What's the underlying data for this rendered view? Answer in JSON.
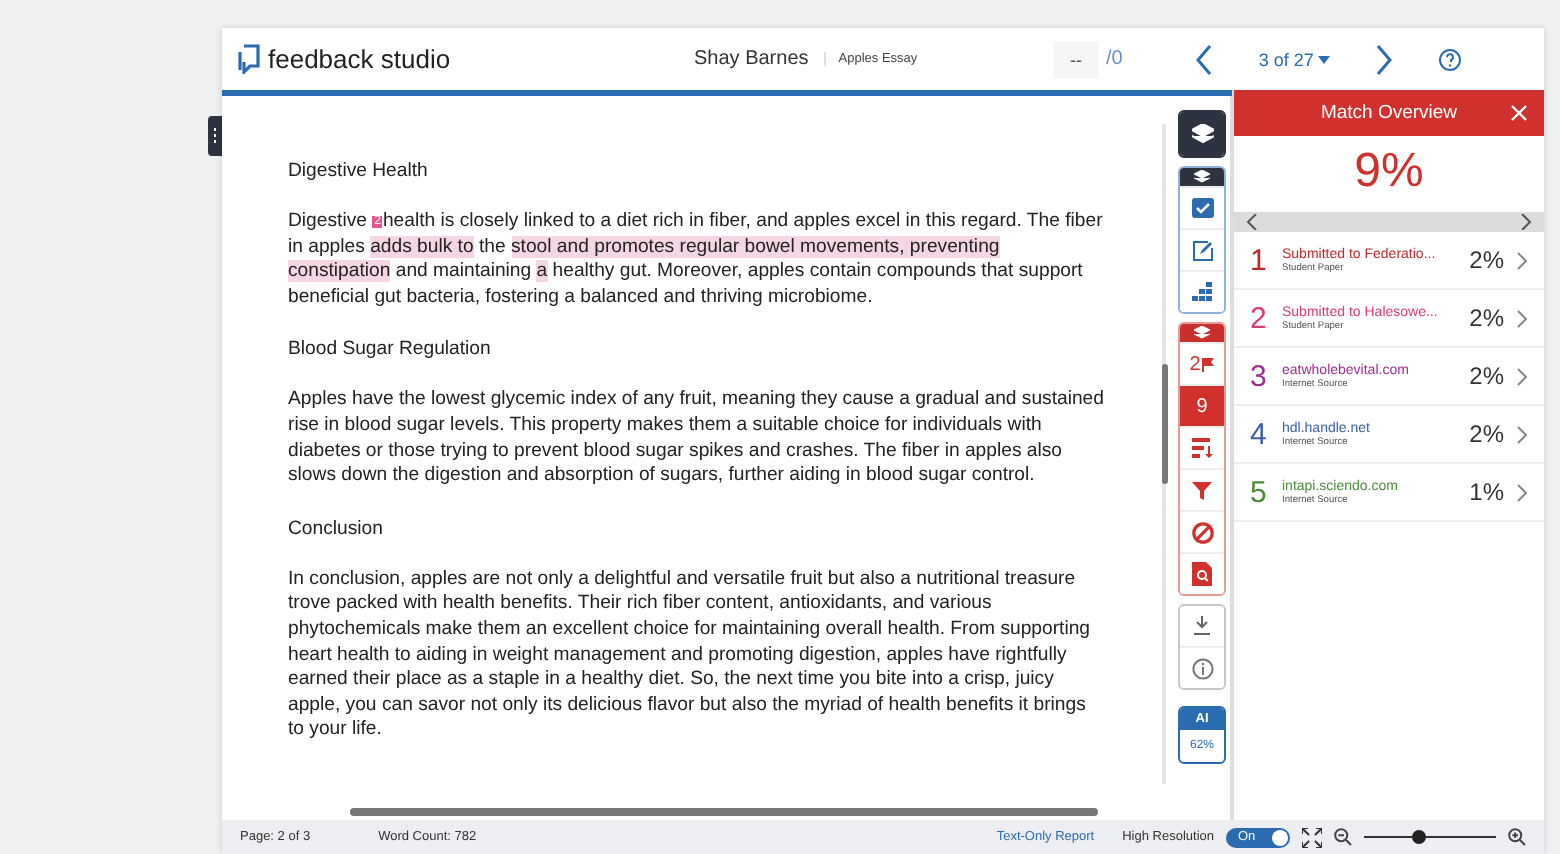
{
  "header": {
    "logo": "feedback studio",
    "student": "Shay Barnes",
    "title": "Apples Essay",
    "grade": "--",
    "grade_total": "/0",
    "position": "3 of 27"
  },
  "document": {
    "blocks": [
      {
        "kind": "heading",
        "text": "Digestive Health"
      },
      {
        "kind": "paragraph",
        "segments": [
          {
            "kind": "plain",
            "text": "Digestive "
          },
          {
            "kind": "marker",
            "text": "2"
          },
          {
            "kind": "plain",
            "text": "health is closely linked to a diet rich in fiber, and apples excel in this regard. The fiber in apples "
          },
          {
            "kind": "match",
            "text": "adds bulk to"
          },
          {
            "kind": "plain",
            "text": " the "
          },
          {
            "kind": "match",
            "text": "stool and promotes regular bowel movements, preventing constipation"
          },
          {
            "kind": "plain",
            "text": " and maintaining "
          },
          {
            "kind": "match",
            "text": "a"
          },
          {
            "kind": "plain",
            "text": " healthy gut. Moreover, apples contain compounds that support beneficial gut bacteria, fostering a balanced and thriving microbiome."
          }
        ]
      },
      {
        "kind": "heading",
        "text": "Blood Sugar Regulation"
      },
      {
        "kind": "paragraph",
        "segments": [
          {
            "kind": "plain",
            "text": "Apples have the lowest glycemic index of any fruit, meaning they cause a gradual and sustained rise in blood sugar levels. This property makes them a suitable choice for individuals with diabetes or those trying to prevent blood sugar spikes and crashes. The fiber in apples also slows down the digestion and absorption of sugars, further aiding in blood sugar control."
          }
        ]
      },
      {
        "kind": "heading",
        "text": "Conclusion"
      },
      {
        "kind": "paragraph",
        "segments": [
          {
            "kind": "plain",
            "text": "In conclusion, apples are not only a delightful and versatile fruit but also a nutritional treasure trove packed with health benefits. Their rich fiber content, antioxidants, and various phytochemicals make them an excellent choice for maintaining overall health. From supporting heart health to aiding in weight management and promoting digestion, apples have rightfully earned their place as a staple in a healthy diet. So, the next time you bite into a crisp, juicy apple, you can savor not only its delicious flavor but also the myriad of health benefits it brings to your life."
          }
        ]
      }
    ]
  },
  "tool_groups": [
    {
      "kind": "layers",
      "tools": [
        {
          "kind": "layers"
        }
      ]
    },
    {
      "kind": "grading",
      "tools": [
        {
          "kind": "head"
        },
        {
          "kind": "check"
        },
        {
          "kind": "edit"
        },
        {
          "kind": "grid"
        }
      ]
    },
    {
      "kind": "similarity",
      "tools": [
        {
          "kind": "head"
        },
        {
          "kind": "flags",
          "label": "2",
          "selected": false
        },
        {
          "kind": "count",
          "label": "9",
          "selected": true
        },
        {
          "kind": "list",
          "selected": false
        },
        {
          "kind": "filter",
          "selected": false
        },
        {
          "kind": "exclude",
          "selected": false
        },
        {
          "kind": "docsearch",
          "selected": false
        }
      ]
    },
    {
      "kind": "misc",
      "tools": [
        {
          "kind": "download"
        },
        {
          "kind": "info"
        }
      ]
    },
    {
      "kind": "ai",
      "label": "AI",
      "value": "62%"
    }
  ],
  "panel": {
    "title": "Match Overview",
    "percent": "9%",
    "matches": [
      {
        "number": "1",
        "source": "Submitted to Federatio...",
        "type": "Student Paper",
        "percent": "2%",
        "color": "#c0272d"
      },
      {
        "number": "2",
        "source": "Submitted to Halesowe...",
        "type": "Student Paper",
        "percent": "2%",
        "color": "#d63c7a"
      },
      {
        "number": "3",
        "source": "eatwholebevital.com",
        "type": "Internet Source",
        "percent": "2%",
        "color": "#9b2f8f"
      },
      {
        "number": "4",
        "source": "hdl.handle.net",
        "type": "Internet Source",
        "percent": "2%",
        "color": "#3a5ea8"
      },
      {
        "number": "5",
        "source": "intapi.sciendo.com",
        "type": "Internet Source",
        "percent": "1%",
        "color": "#4a8c3a"
      }
    ]
  },
  "footer": {
    "page": "Page: 2 of 3",
    "word_count": "Word Count: 782",
    "text_only": "Text-Only Report",
    "resolution_label": "High Resolution",
    "toggle": {
      "label": "On",
      "on": true
    },
    "zoom": {
      "level": 0.42
    }
  }
}
